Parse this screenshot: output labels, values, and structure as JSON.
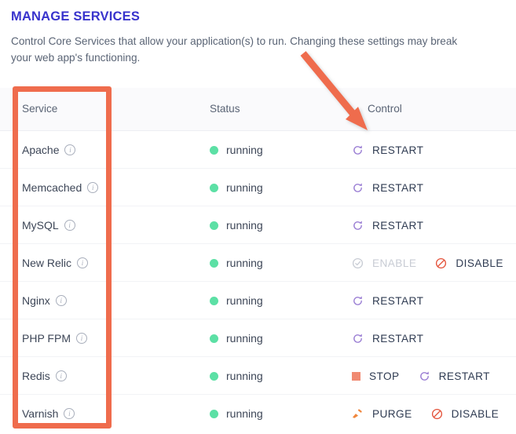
{
  "header": {
    "title": "MANAGE SERVICES",
    "description": "Control Core Services that allow your application(s) to run. Changing these settings may break your web app's functioning."
  },
  "colors": {
    "title": "#3833CC",
    "body_text": "#5A6475",
    "cell_text": "#3D4657",
    "status_running": "#5CE0A5",
    "restart_icon": "#9B7FD4",
    "stop_icon": "#F08A72",
    "disable_icon": "#E4533B",
    "purge_icon": "#F0873E",
    "disabled_text": "#C8CCD4",
    "annotation": "#EF6C4D",
    "header_row_bg": "#FAFAFC"
  },
  "table": {
    "columns": [
      "Service",
      "Status",
      "Control"
    ],
    "rows": [
      {
        "service": "Apache",
        "info_icon": "info-icon",
        "status": "running",
        "status_icon": "green-dot-icon",
        "actions": [
          {
            "label": "RESTART",
            "icon": "refresh-icon",
            "state": "enabled"
          }
        ]
      },
      {
        "service": "Memcached",
        "info_icon": "info-icon",
        "status": "running",
        "status_icon": "green-dot-icon",
        "actions": [
          {
            "label": "RESTART",
            "icon": "refresh-icon",
            "state": "enabled"
          }
        ]
      },
      {
        "service": "MySQL",
        "info_icon": "info-icon",
        "status": "running",
        "status_icon": "green-dot-icon",
        "actions": [
          {
            "label": "RESTART",
            "icon": "refresh-icon",
            "state": "enabled"
          }
        ]
      },
      {
        "service": "New Relic",
        "info_icon": "info-icon",
        "status": "running",
        "status_icon": "green-dot-icon",
        "actions": [
          {
            "label": "ENABLE",
            "icon": "check-circle-icon",
            "state": "disabled"
          },
          {
            "label": "DISABLE",
            "icon": "prohibition-icon",
            "state": "enabled"
          }
        ]
      },
      {
        "service": "Nginx",
        "info_icon": "info-icon",
        "status": "running",
        "status_icon": "green-dot-icon",
        "actions": [
          {
            "label": "RESTART",
            "icon": "refresh-icon",
            "state": "enabled"
          }
        ]
      },
      {
        "service": "PHP FPM",
        "info_icon": "info-icon",
        "status": "running",
        "status_icon": "green-dot-icon",
        "actions": [
          {
            "label": "RESTART",
            "icon": "refresh-icon",
            "state": "enabled"
          }
        ]
      },
      {
        "service": "Redis",
        "info_icon": "info-icon",
        "status": "running",
        "status_icon": "green-dot-icon",
        "actions": [
          {
            "label": "STOP",
            "icon": "stop-square-icon",
            "state": "enabled"
          },
          {
            "label": "RESTART",
            "icon": "refresh-icon",
            "state": "enabled"
          }
        ]
      },
      {
        "service": "Varnish",
        "info_icon": "info-icon",
        "status": "running",
        "status_icon": "green-dot-icon",
        "actions": [
          {
            "label": "PURGE",
            "icon": "broom-icon",
            "state": "enabled"
          },
          {
            "label": "DISABLE",
            "icon": "prohibition-icon",
            "state": "enabled"
          }
        ]
      }
    ]
  },
  "annotations": {
    "highlight_rect": "service-column-highlight",
    "arrow": "control-column-arrow"
  }
}
